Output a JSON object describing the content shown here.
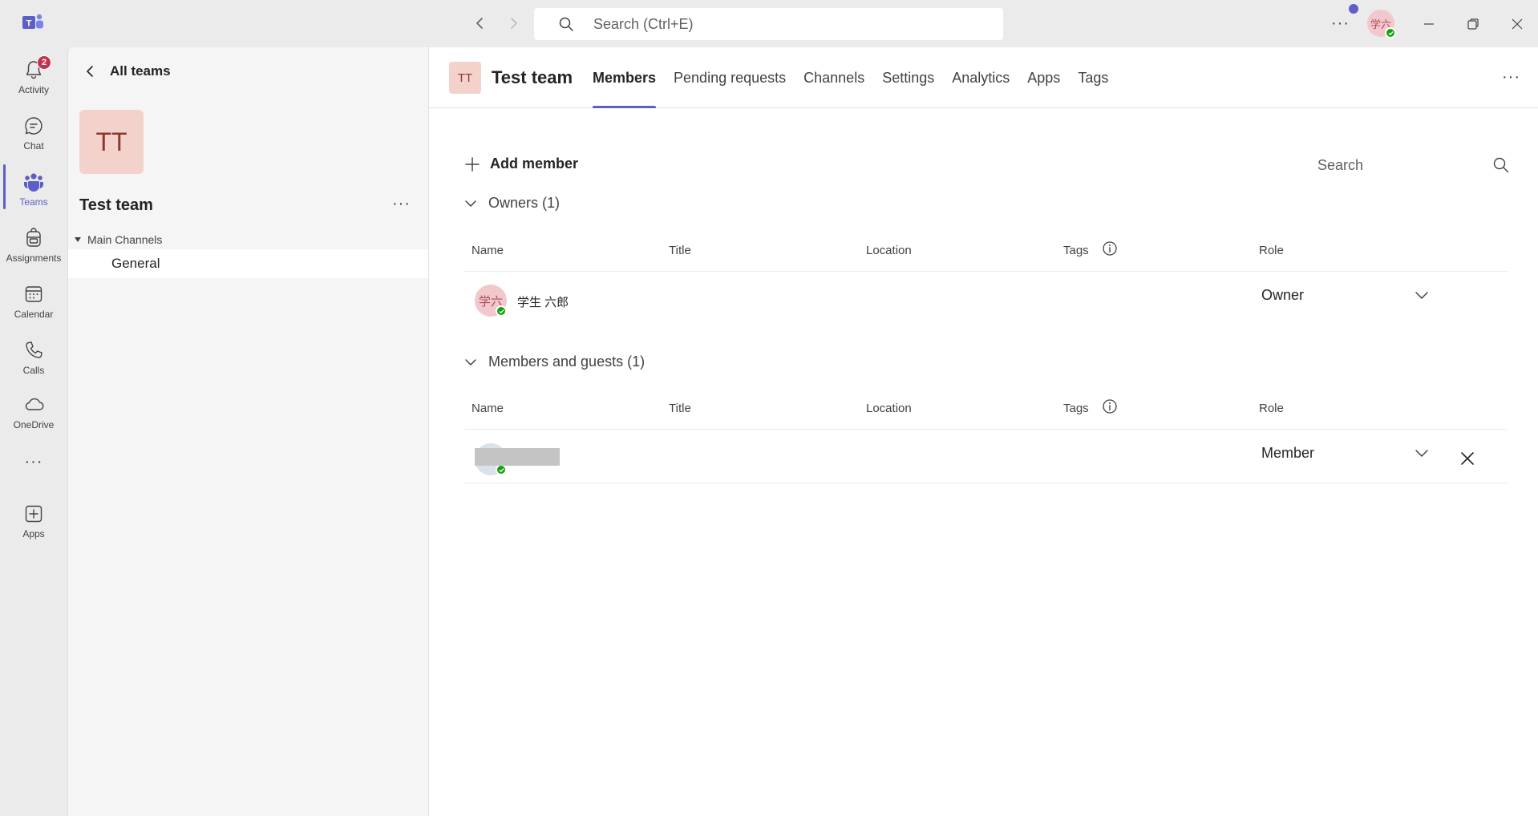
{
  "titlebar": {
    "search_placeholder": "Search (Ctrl+E)",
    "more_label": "···",
    "user_initials": "学六"
  },
  "rail": {
    "items": [
      {
        "label": "Activity",
        "icon": "bell-icon",
        "badge": "2"
      },
      {
        "label": "Chat",
        "icon": "chat-icon"
      },
      {
        "label": "Teams",
        "icon": "teams-icon",
        "active": true
      },
      {
        "label": "Assignments",
        "icon": "backpack-icon"
      },
      {
        "label": "Calendar",
        "icon": "calendar-icon"
      },
      {
        "label": "Calls",
        "icon": "phone-icon"
      },
      {
        "label": "OneDrive",
        "icon": "cloud-icon"
      },
      {
        "label": "···",
        "icon": "more-icon"
      },
      {
        "label": "Apps",
        "icon": "apps-add-icon"
      }
    ]
  },
  "team_pane": {
    "back_label": "All teams",
    "team_initials": "TT",
    "team_name": "Test team",
    "more_label": "···",
    "channels_group": "Main Channels",
    "channels": [
      "General"
    ]
  },
  "header": {
    "team_initials": "TT",
    "team_name": "Test team",
    "tabs": [
      "Members",
      "Pending requests",
      "Channels",
      "Settings",
      "Analytics",
      "Apps",
      "Tags"
    ],
    "active_tab": "Members",
    "more_label": "···"
  },
  "members": {
    "add_member_label": "Add member",
    "search_placeholder": "Search",
    "columns": [
      "Name",
      "Title",
      "Location",
      "Tags",
      "Role"
    ],
    "owners": {
      "heading": "Owners (1)",
      "rows": [
        {
          "initials": "学六",
          "name": "学生 六郎",
          "role": "Owner"
        }
      ]
    },
    "members_guests": {
      "heading": "Members and guests (1)",
      "rows": [
        {
          "initials": "",
          "name": "",
          "role": "Member"
        }
      ]
    }
  },
  "colors": {
    "accent": "#5b5fc7",
    "presence": "#13a10e",
    "badge": "#c4314b",
    "team_tile": "#f3d2cc"
  }
}
